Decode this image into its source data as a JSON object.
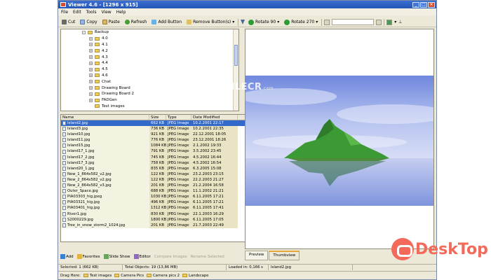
{
  "window": {
    "title": "Viewer 4.6 - [1296 x 915]"
  },
  "menu": [
    "File",
    "Edit",
    "Tools",
    "View",
    "Help"
  ],
  "toolbar_left": {
    "cut": "Cut",
    "copy": "Copy",
    "paste": "Paste",
    "refresh": "Refresh",
    "add_button": "Add Button",
    "remove_buttons": "Remove Button(s)"
  },
  "toolbar_right": {
    "rotate_90": "Rotate 90",
    "rotate_270": "Rotate 270"
  },
  "folder_tree": [
    {
      "label": "Backup",
      "expander": "-",
      "indent": 0
    },
    {
      "label": "4.0",
      "expander": "+",
      "indent": 1
    },
    {
      "label": "4.1",
      "expander": "+",
      "indent": 1
    },
    {
      "label": "4.2",
      "expander": "+",
      "indent": 1
    },
    {
      "label": "4.3",
      "expander": "+",
      "indent": 1
    },
    {
      "label": "4.4",
      "expander": "+",
      "indent": 1
    },
    {
      "label": "4.5",
      "expander": "+",
      "indent": 1
    },
    {
      "label": "4.6",
      "expander": "+",
      "indent": 1
    },
    {
      "label": "Chat",
      "expander": "+",
      "indent": 1
    },
    {
      "label": "Drawing Board",
      "expander": "+",
      "indent": 1
    },
    {
      "label": "Drawing Board 2",
      "expander": "+",
      "indent": 1
    },
    {
      "label": "FADGen",
      "expander": "+",
      "indent": 1
    },
    {
      "label": "Test images",
      "expander": "",
      "indent": 1
    }
  ],
  "file_list": {
    "headers": [
      "Name",
      "Size",
      "Type",
      "Date Modified"
    ],
    "rows": [
      {
        "name": "Island2.jpg",
        "size": "662 KB",
        "type": "JPEG Image",
        "date": "10.2.2001 22:17",
        "selected": true
      },
      {
        "name": "Island3.jpg",
        "size": "736 KB",
        "type": "JPEG Image",
        "date": "10.2.2001 22:35"
      },
      {
        "name": "Island10.jpg",
        "size": "921 KB",
        "type": "JPEG Image",
        "date": "22.12.2001 18:05"
      },
      {
        "name": "Island11.jpg",
        "size": "776 KB",
        "type": "JPEG Image",
        "date": "23.12.2001 18:26"
      },
      {
        "name": "Island15.jpg",
        "size": "1084 KB",
        "type": "JPEG Image",
        "date": "2.1.2002 19:33"
      },
      {
        "name": "Island17_1.jpg",
        "size": "791 KB",
        "type": "JPEG Image",
        "date": "3.5.2002 23:45"
      },
      {
        "name": "Island17_2.jpg",
        "size": "745 KB",
        "type": "JPEG Image",
        "date": "4.5.2002 16:44"
      },
      {
        "name": "Island17_3.jpg",
        "size": "758 KB",
        "type": "JPEG Image",
        "date": "4.5.2002 16:54"
      },
      {
        "name": "Island20_1.jpg",
        "size": "835 KB",
        "type": "JPEG Image",
        "date": "6.3.2005 15:08"
      },
      {
        "name": "New_1_864x582_v2.jpg",
        "size": "122 KB",
        "type": "JPEG Image",
        "date": "23.2.2003 23:15"
      },
      {
        "name": "New_2_864x582_v2.jpg",
        "size": "122 KB",
        "type": "JPEG Image",
        "date": "22.2.2003 21:27"
      },
      {
        "name": "New_2_864x582_v3.jpg",
        "size": "201 KB",
        "type": "JPEG Image",
        "date": "21.2.2004 16:58"
      },
      {
        "name": "Outer_Space.jpg",
        "size": "688 KB",
        "type": "JPEG Image",
        "date": "11.1.2002 21:21"
      },
      {
        "name": "PIA03303_hig.jpeg",
        "size": "1030 KB",
        "type": "JPEG Image",
        "date": "6.11.2005 17:21"
      },
      {
        "name": "PIA03321_hig.jpg",
        "size": "496 KB",
        "type": "JPEG Image",
        "date": "6.11.2005 17:21"
      },
      {
        "name": "PIA03401_hig.jpg",
        "size": "1312 KB",
        "type": "JPEG Image",
        "date": "6.11.2005 17:41"
      },
      {
        "name": "River1.jpg",
        "size": "830 KB",
        "type": "JPEG Image",
        "date": "22.1.2003 16:29"
      },
      {
        "name": "S2000229.jpg",
        "size": "1800 KB",
        "type": "JPEG Image",
        "date": "6.11.2005 17:05"
      },
      {
        "name": "Tree_in_snow_storm2_1024.jpg",
        "size": "201 KB",
        "type": "JPEG Image",
        "date": "21.7.2003 22:49"
      }
    ]
  },
  "bottom_bar": {
    "add": "Add",
    "favorites": "Favorites",
    "slide_show": "Slide Show",
    "editor": "Editor",
    "compare_images": "Compare Images",
    "rename_selected": "Rename Selected"
  },
  "viewer_tabs": [
    "Preview",
    "Thumbview"
  ],
  "status": {
    "selected": "Selected: 1 (662 KB)",
    "total": "Total Objects: 19 (13,86 MB)",
    "loaded": "Loaded in: 0,166 s",
    "file": "Island2.jpg"
  },
  "drag_bar": {
    "label": "Drag Here:",
    "folders": [
      "Test images",
      "Camera Pics",
      "Camera pics 2",
      "Landscape"
    ]
  },
  "watermarks": {
    "filecr": "FILECR",
    "filecr_suffix": ".com",
    "desktop": "DeskTop"
  },
  "colors": {
    "title_bar": "#2456b8",
    "selection": "#3369c8",
    "highlight_column": "#e9e5c4",
    "sky": "#8da5e8",
    "island": "#3c9a35"
  }
}
